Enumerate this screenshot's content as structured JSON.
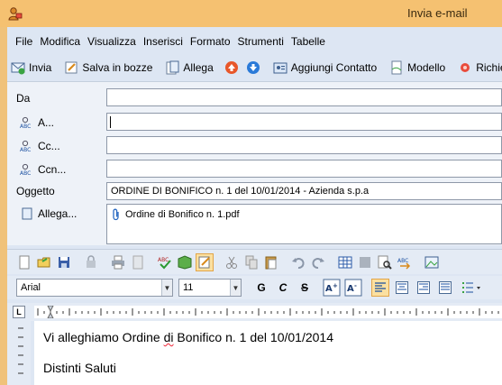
{
  "window": {
    "title": "Invia e-mail"
  },
  "menu": [
    "File",
    "Modifica",
    "Visualizza",
    "Inserisci",
    "Formato",
    "Strumenti",
    "Tabelle"
  ],
  "toolbar": {
    "send": "Invia",
    "save_draft": "Salva in bozze",
    "attach": "Allega",
    "add_contact": "Aggiungi Contatto",
    "template": "Modello",
    "request": "Richie"
  },
  "fields": {
    "from": {
      "label": "Da",
      "value": ""
    },
    "to": {
      "label": "A...",
      "value": ""
    },
    "cc": {
      "label": "Cc...",
      "value": ""
    },
    "bcc": {
      "label": "Ccn...",
      "value": ""
    },
    "subject": {
      "label": "Oggetto",
      "value": "ORDINE DI BONIFICO n. 1 del 10/01/2014 - Azienda s.p.a"
    },
    "attachments": {
      "label": "Allega...",
      "files": [
        "Ordine di Bonifico n. 1.pdf"
      ]
    }
  },
  "format": {
    "font": "Arial",
    "size": "11",
    "bold": "G",
    "italic": "C",
    "strike": "S"
  },
  "ruler": {
    "corner": "L"
  },
  "body": {
    "line1_pre": "Vi alleghiamo Ordine ",
    "line1_mis": "di",
    "line1_post": " Bonifico n. 1 del 10/01/2014",
    "line2": "Distinti Saluti"
  },
  "colors": {
    "title_bar": "#f5c171",
    "window": "#dde6f3",
    "accent": "#e2a548"
  }
}
